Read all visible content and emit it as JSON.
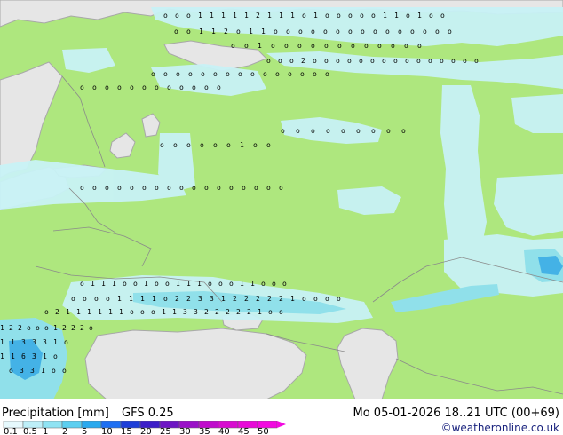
{
  "header": {
    "title": "Precipitation [mm]",
    "model": "GFS 0.25",
    "valid_time": "Mo 05-01-2026 18..21 UTC (00+69)",
    "attribution": "©weatheronline.co.uk"
  },
  "legend": {
    "ticks": [
      "0.1",
      "0.5",
      "1",
      "2",
      "5",
      "10",
      "15",
      "20",
      "25",
      "30",
      "35",
      "40",
      "45",
      "50"
    ],
    "colors": [
      "#e6f9fd",
      "#bdeff8",
      "#8fe3f3",
      "#5ccff0",
      "#2aa9ee",
      "#1e6ff2",
      "#1e3fd8",
      "#3c1ec8",
      "#6e16c4",
      "#9a10c8",
      "#c00ccc",
      "#d80cd0",
      "#e80ad8",
      "#f20ae0"
    ]
  },
  "colors": {
    "land": "#aee77e",
    "sea": "#e6e6e6",
    "coast": "#a8a8a8",
    "border": "#8a8a8a",
    "precip_light": "#c8f2f6",
    "precip_mid": "#8fe0f0",
    "precip_strong": "#3fb0ec"
  },
  "map": {
    "grid_rows": [
      "o o o 1 1 1 1 1 2 1 1 1 o 1 o o o o o 1 1 o 1 o o",
      "o o 1 1 2 o 1 1 o o o o o o o o o o o o o o o",
      "o o 1 o o o o o o o o o o o o",
      "o o o 2 o o o o o o o o o o o o o o o",
      "o o o o o o o o o o o o o o o",
      "o o o o o o o o o o o o",
      "o o o o o o o o o",
      "o o o o o o 1 o o",
      "o o o o o o o o o o o o o o o o o",
      "o 1 1 1 o o 1 o o 1 1 1 o o o 1 1 o o o",
      "o o o o 1 1 1 1 o 2 2 3 3 1 2 2 2 2 2 1 o o o o",
      "o 2 1 1 1 1 1 1 o o o 1 1 3 3 2 2 2 2 2 1 o o",
      "1 2 2 o o o 1 2 2 2 o",
      "1 1 3 3 3 1 o",
      "1 1 6 3 1 o",
      "o 3 3 1 o o"
    ]
  }
}
